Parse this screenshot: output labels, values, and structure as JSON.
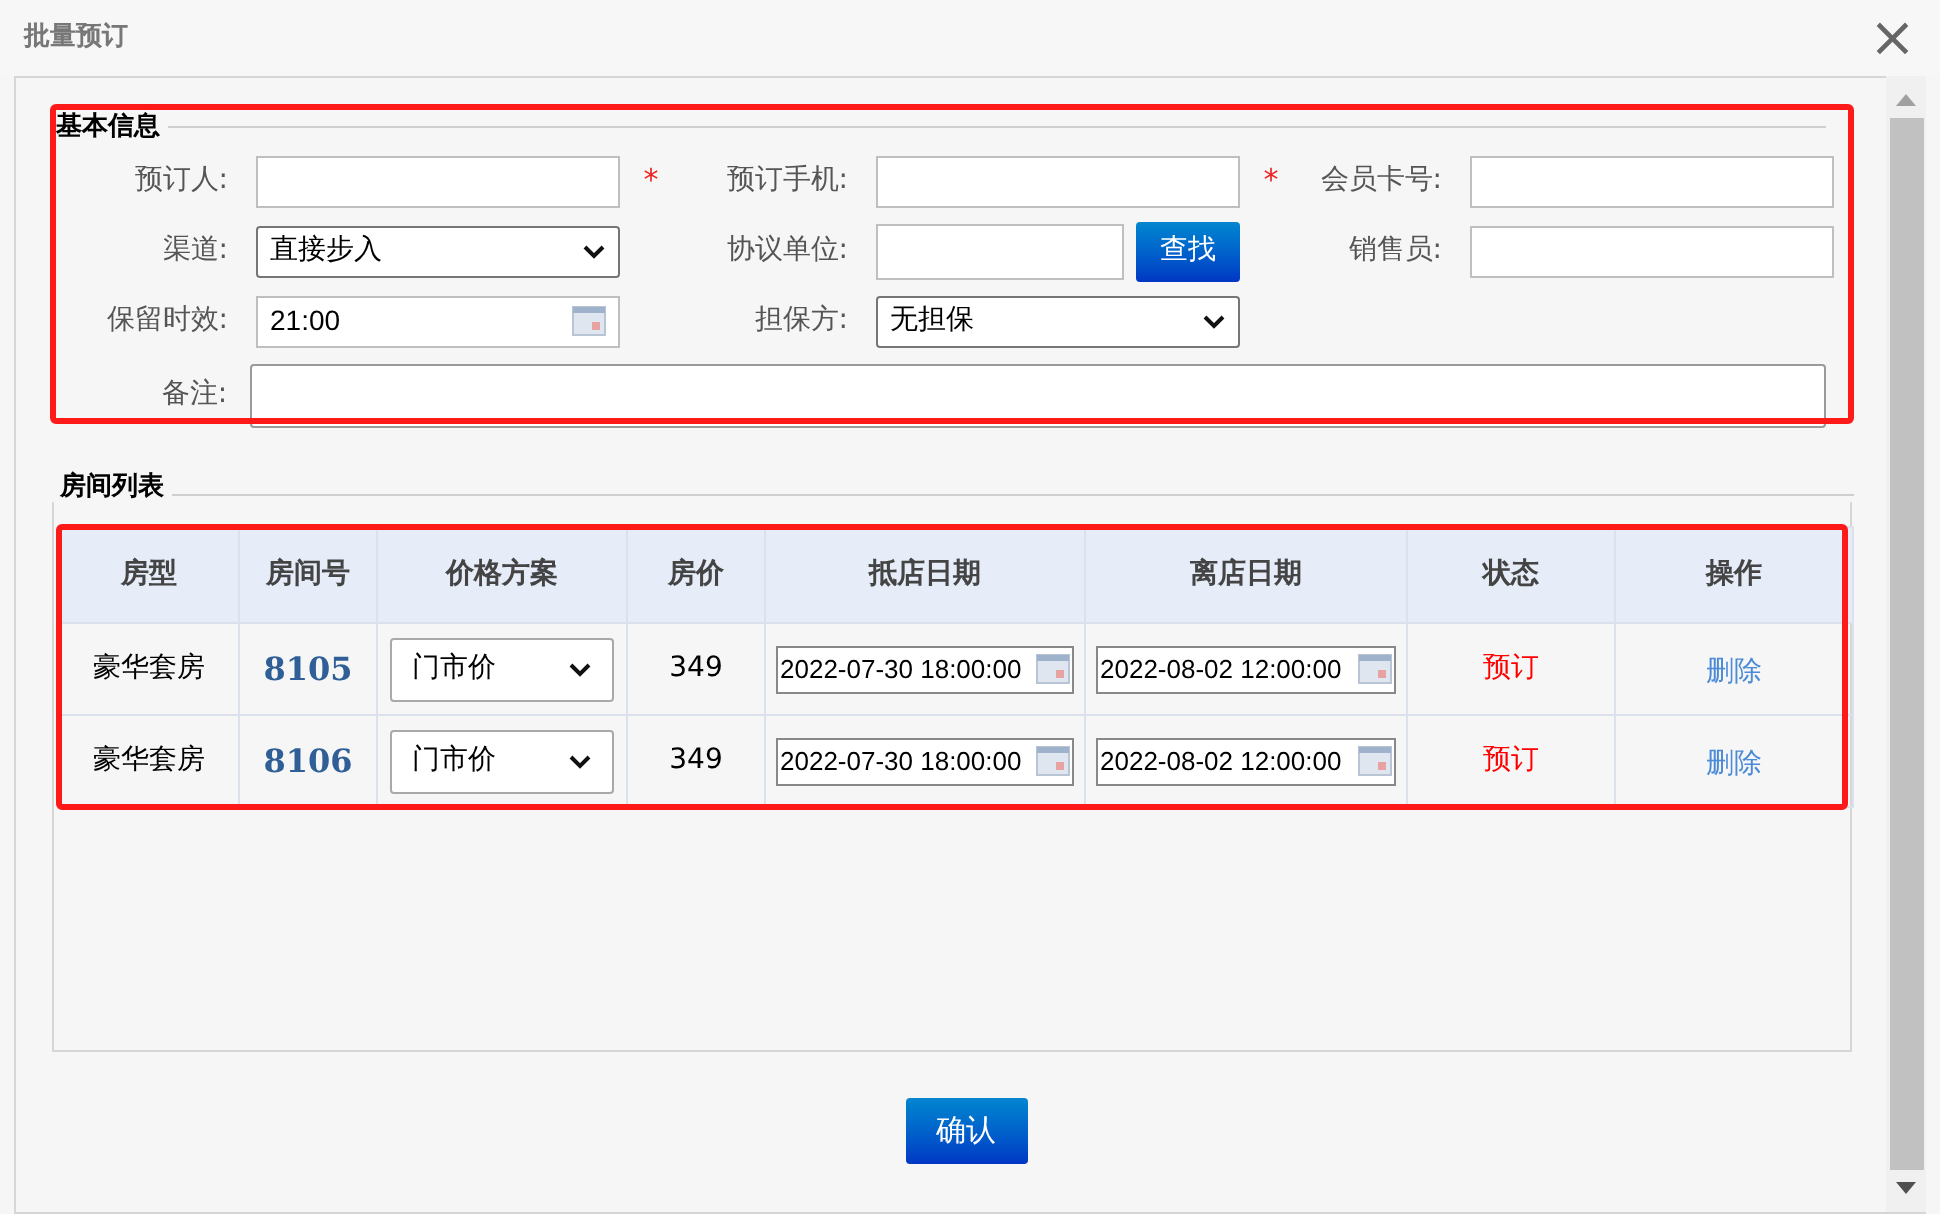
{
  "window": {
    "title": "批量预订",
    "close": "×"
  },
  "basic_info": {
    "legend": "基本信息",
    "rows": [
      [
        {
          "label": "预订人:",
          "kind": "text",
          "mark": "*"
        },
        {
          "label": "预订手机:",
          "kind": "text",
          "mark": "*"
        },
        {
          "label": "会员卡号:",
          "kind": "text"
        }
      ],
      [
        {
          "label": "渠道:",
          "kind": "select",
          "value": "直接步入"
        },
        {
          "label": "协议单位:",
          "kind": "search",
          "button": "查找"
        },
        {
          "label": "销售员:",
          "kind": "text"
        }
      ],
      [
        {
          "label": "保留时效:",
          "kind": "date",
          "value": "21:00"
        },
        {
          "label": "担保方:",
          "kind": "select",
          "value": "无担保"
        }
      ]
    ],
    "remark": {
      "label": "备注:"
    }
  },
  "rooms": {
    "legend": "房间列表",
    "columns": [
      "房型",
      "房间号",
      "价格方案",
      "房价",
      "抵店日期",
      "离店日期",
      "状态",
      "操作"
    ],
    "rows": [
      {
        "type": "豪华套房",
        "number": "8105",
        "plan": "门市价",
        "price": "349",
        "checkin": "2022-07-30 18:00:00",
        "checkout": "2022-08-02 12:00:00",
        "status": "预订",
        "action": "删除"
      },
      {
        "type": "豪华套房",
        "number": "8106",
        "plan": "门市价",
        "price": "349",
        "checkin": "2022-07-30 18:00:00",
        "checkout": "2022-08-02 12:00:00",
        "status": "预订",
        "action": "删除"
      }
    ]
  },
  "confirm": "确认"
}
